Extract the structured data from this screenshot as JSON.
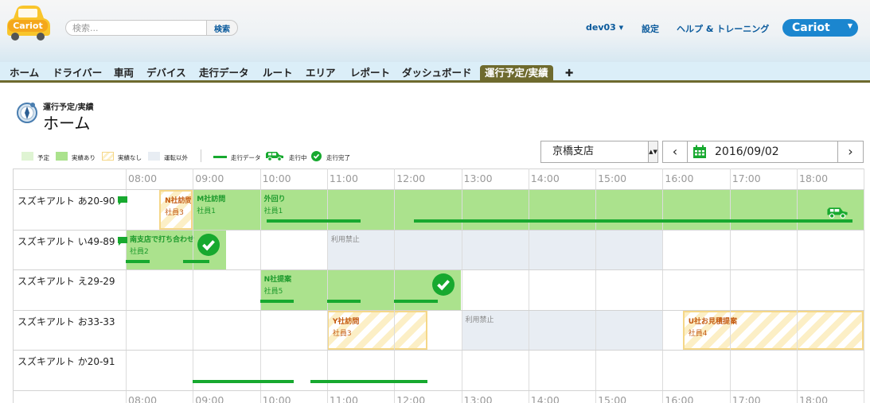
{
  "header": {
    "logo_text": "Cariot",
    "search_placeholder": "検索...",
    "search_button": "検索",
    "user_menu": "dev03 ▾",
    "settings": "設定",
    "help": "ヘルプ & トレーニング",
    "app_switcher": "Cariot"
  },
  "tabs": [
    "ホーム",
    "ドライバー",
    "車両",
    "デバイス",
    "走行データ",
    "ルート",
    "エリア",
    "レポート",
    "ダッシュボード",
    "運行予定/実績",
    "✚"
  ],
  "active_tab": 9,
  "page": {
    "subtitle": "運行予定/実績",
    "title": "ホーム"
  },
  "legend": {
    "items": [
      {
        "label": "予定",
        "color": "#dff4d3",
        "style": "solid"
      },
      {
        "label": "実績あり",
        "color": "#abe28d",
        "style": "solid"
      },
      {
        "label": "実績なし",
        "color": "#fcefc6",
        "style": "hatched"
      },
      {
        "label": "運転以外",
        "color": "#e8edf3",
        "style": "solid"
      }
    ],
    "trip_label": "走行データ",
    "driving_label": "走行中",
    "done_label": "走行完了"
  },
  "controls": {
    "branch": "京橋支店",
    "date": "2016/09/02",
    "prev": "‹",
    "next": "›"
  },
  "schedule": {
    "hours": [
      "08:00",
      "09:00",
      "10:00",
      "11:00",
      "12:00",
      "13:00",
      "14:00",
      "15:00",
      "16:00",
      "17:00",
      "18:00"
    ],
    "rows": [
      {
        "vehicle": "スズキアルト あ20-90",
        "message": true,
        "blocks": [
          {
            "type": "planned-none",
            "start": 8.5,
            "end": 9.0,
            "title": "N社訪問",
            "sub": "社員3"
          },
          {
            "type": "actual",
            "start": 9.0,
            "end": 10.0,
            "title": "M社訪問",
            "sub": "社員1"
          },
          {
            "type": "actual",
            "start": 10.0,
            "end": 19.0,
            "title": "外回り",
            "sub": "社員1",
            "driving": true
          }
        ],
        "trips": [
          [
            10.1,
            11.5
          ],
          [
            12.3,
            19.0
          ]
        ]
      },
      {
        "vehicle": "スズキアルト い49-89",
        "message": true,
        "blocks": [
          {
            "type": "actual",
            "start": 8.0,
            "end": 9.5,
            "title": "南支店で打ち合わせ",
            "sub": "社員2",
            "done": true
          },
          {
            "type": "restricted",
            "start": 11.0,
            "end": 16.0,
            "title": "利用禁止",
            "sub": ""
          }
        ],
        "trips": [
          [
            8.0,
            8.35
          ],
          [
            8.85,
            9.25
          ]
        ]
      },
      {
        "vehicle": "スズキアルト え29-29",
        "message": false,
        "blocks": [
          {
            "type": "actual",
            "start": 10.0,
            "end": 13.0,
            "title": "N社提案",
            "sub": "社員5",
            "done": true
          }
        ],
        "trips": [
          [
            10.0,
            10.5
          ],
          [
            11.0,
            11.5
          ],
          [
            12.0,
            12.65
          ]
        ]
      },
      {
        "vehicle": "スズキアルト お33-33",
        "message": false,
        "blocks": [
          {
            "type": "planned-none",
            "start": 11.0,
            "end": 12.5,
            "title": "Y社訪問",
            "sub": "社員3"
          },
          {
            "type": "restricted",
            "start": 13.0,
            "end": 16.0,
            "title": "利用禁止",
            "sub": ""
          },
          {
            "type": "planned-none",
            "start": 16.3,
            "end": 19.0,
            "title": "U社お見積提案",
            "sub": "社員4"
          }
        ],
        "trips": []
      },
      {
        "vehicle": "スズキアルト か20-91",
        "message": false,
        "blocks": [],
        "trips": [
          [
            9.0,
            10.5
          ],
          [
            10.75,
            12.5
          ]
        ]
      }
    ]
  },
  "colors": {
    "accent": "#1b86cf",
    "active_tab": "#6e6a2e",
    "link": "#0a5a9c",
    "trip": "#17a92f"
  }
}
